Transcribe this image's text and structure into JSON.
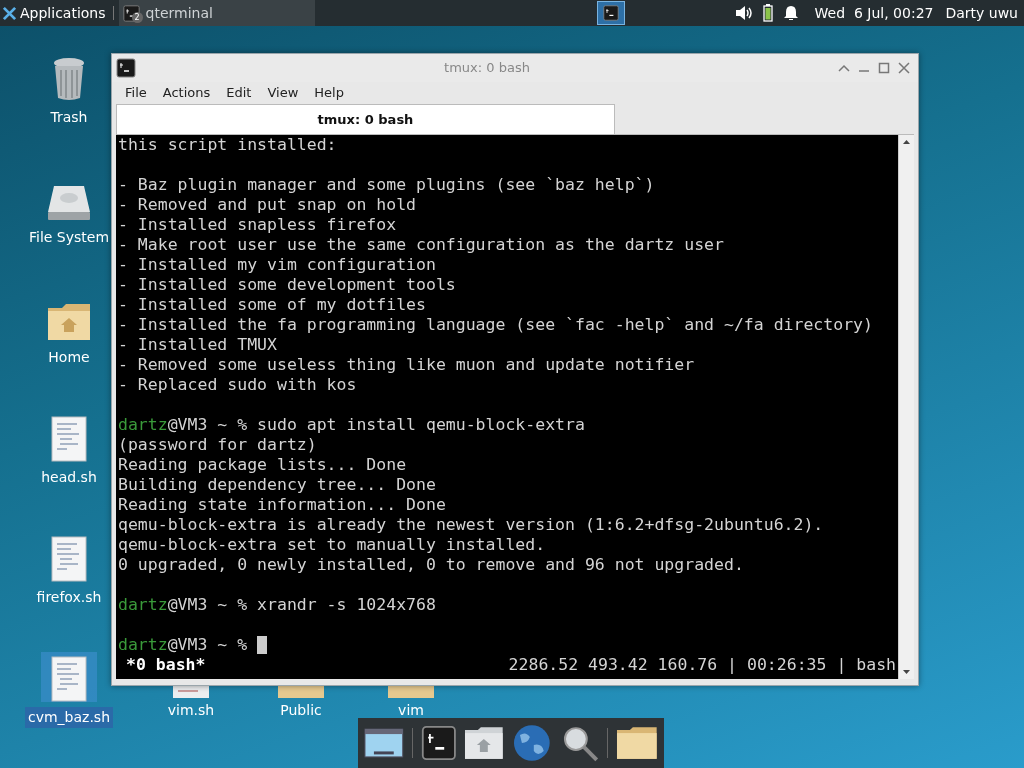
{
  "top_panel": {
    "menu_label": "Applications",
    "task": {
      "label": "qterminal",
      "badge": "2"
    },
    "clock": "Wed  6 Jul, 00:27",
    "user": "Darty uwu"
  },
  "desktop_icons": [
    {
      "label": "Trash",
      "kind": "trash",
      "selected": false
    },
    {
      "label": "File System",
      "kind": "drive",
      "selected": false
    },
    {
      "label": "Home",
      "kind": "home",
      "selected": false
    },
    {
      "label": "head.sh",
      "kind": "script",
      "selected": false
    },
    {
      "label": "firefox.sh",
      "kind": "script",
      "selected": false
    },
    {
      "label": "cvm_baz.sh",
      "kind": "script",
      "selected": true
    }
  ],
  "bottom_icons": [
    {
      "label": "vim.sh",
      "kind": "script"
    },
    {
      "label": "Public",
      "kind": "folder"
    },
    {
      "label": "vim",
      "kind": "folder"
    }
  ],
  "window": {
    "title": "tmux: 0 bash",
    "menu": [
      "File",
      "Actions",
      "Edit",
      "View",
      "Help"
    ],
    "tab": "tmux: 0 bash",
    "lines": [
      {
        "kind": "text",
        "text": "this script installed:"
      },
      {
        "kind": "blank"
      },
      {
        "kind": "text",
        "text": "- Baz plugin manager and some plugins (see `baz help`)"
      },
      {
        "kind": "text",
        "text": "- Removed and put snap on hold"
      },
      {
        "kind": "text",
        "text": "- Installed snapless firefox"
      },
      {
        "kind": "text",
        "text": "- Make root user use the same configuration as the dartz user"
      },
      {
        "kind": "text",
        "text": "- Installed my vim configuration"
      },
      {
        "kind": "text",
        "text": "- Installed some development tools"
      },
      {
        "kind": "text",
        "text": "- Installed some of my dotfiles"
      },
      {
        "kind": "text",
        "text": "- Installed the fa programming language (see `fac -help` and ~/fa directory)"
      },
      {
        "kind": "text",
        "text": "- Installed TMUX"
      },
      {
        "kind": "text",
        "text": "- Removed some useless thing like muon and update notifier"
      },
      {
        "kind": "text",
        "text": "- Replaced sudo with kos"
      },
      {
        "kind": "blank"
      },
      {
        "kind": "prompt",
        "user": "dartz",
        "text": "@VM3 ~ % sudo apt install qemu-block-extra"
      },
      {
        "kind": "text",
        "text": "(password for dartz)"
      },
      {
        "kind": "text",
        "text": "Reading package lists... Done"
      },
      {
        "kind": "text",
        "text": "Building dependency tree... Done"
      },
      {
        "kind": "text",
        "text": "Reading state information... Done"
      },
      {
        "kind": "text",
        "text": "qemu-block-extra is already the newest version (1:6.2+dfsg-2ubuntu6.2)."
      },
      {
        "kind": "text",
        "text": "qemu-block-extra set to manually installed."
      },
      {
        "kind": "text",
        "text": "0 upgraded, 0 newly installed, 0 to remove and 96 not upgraded."
      },
      {
        "kind": "blank"
      },
      {
        "kind": "prompt",
        "user": "dartz",
        "text": "@VM3 ~ % xrandr -s 1024x768"
      },
      {
        "kind": "blank"
      },
      {
        "kind": "cursor",
        "user": "dartz",
        "text": "@VM3 ~ % "
      }
    ],
    "status_left": "*0 bash*",
    "status_right": "2286.52 493.42 160.76 | 00:26:35 | bash"
  }
}
